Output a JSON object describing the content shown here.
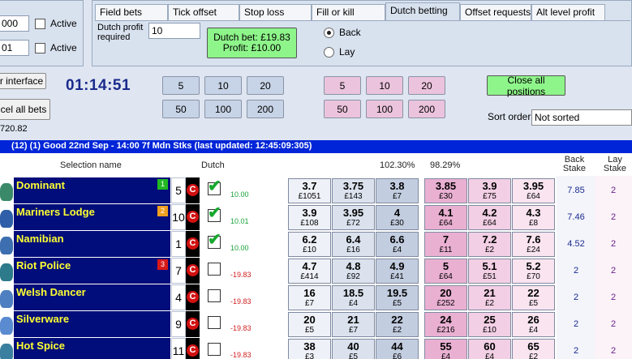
{
  "left_panel": {
    "input1": "000",
    "input2": "01",
    "active_label": "Active"
  },
  "tabs": [
    {
      "label": "Field bets"
    },
    {
      "label": "Tick offset"
    },
    {
      "label": "Stop loss"
    },
    {
      "label": "Fill or kill"
    },
    {
      "label": "Dutch betting"
    },
    {
      "label": "Offset requests"
    },
    {
      "label": "Alt level profit"
    }
  ],
  "dutch": {
    "profit_label_line1": "Dutch profit",
    "profit_label_line2": "required",
    "profit_value": "10",
    "bet_line1": "Dutch bet: £19.83",
    "bet_line2": "Profit: £10.00",
    "back_label": "Back",
    "lay_label": "Lay",
    "selected": "Back"
  },
  "controls": {
    "interface_btn": "r interface",
    "cancel_btn": "cel all bets",
    "balance": "720.82",
    "timer": "01:14:51",
    "back_stakes": [
      "5",
      "10",
      "20",
      "50",
      "100",
      "200"
    ],
    "lay_stakes": [
      "5",
      "10",
      "20",
      "50",
      "100",
      "200"
    ],
    "close_positions": "Close all positions",
    "sort_label": "Sort order",
    "sort_value": "Not sorted"
  },
  "banner": "(12) (1)        Good 22nd Sep - 14:00 7f Mdn Stks (last updated: 12:45:09:305)",
  "headers": {
    "selection": "Selection name",
    "dutch": "Dutch",
    "back_book": "102.30%",
    "lay_book": "98.29%",
    "back_stake_1": "Back",
    "back_stake_2": "Stake",
    "lay_stake_1": "Lay",
    "lay_stake_2": "Stake"
  },
  "colors": {
    "name_bg": "#000d7a",
    "name_fg": "#ffff33",
    "banner": "#0025d8",
    "close_green": "#8ef58a"
  },
  "runners": [
    {
      "name": "Dominant",
      "badge": "1",
      "badge_color": "#22b922",
      "cloth": "5",
      "checked": true,
      "profit": "10.00",
      "back": [
        {
          "p": "3.7",
          "v": "£1051"
        },
        {
          "p": "3.75",
          "v": "£143"
        },
        {
          "p": "3.8",
          "v": "£7"
        }
      ],
      "lay": [
        {
          "p": "3.85",
          "v": "£30"
        },
        {
          "p": "3.9",
          "v": "£75"
        },
        {
          "p": "3.95",
          "v": "£64"
        }
      ],
      "back_stake": "7.85",
      "lay_stake": "2",
      "silk": "#3a8a6a"
    },
    {
      "name": "Mariners Lodge",
      "badge": "2",
      "badge_color": "#f0a020",
      "cloth": "10",
      "checked": true,
      "profit": "10.01",
      "back": [
        {
          "p": "3.9",
          "v": "£108"
        },
        {
          "p": "3.95",
          "v": "£72"
        },
        {
          "p": "4",
          "v": "£30"
        }
      ],
      "lay": [
        {
          "p": "4.1",
          "v": "£64"
        },
        {
          "p": "4.2",
          "v": "£64"
        },
        {
          "p": "4.3",
          "v": "£8"
        }
      ],
      "back_stake": "7.46",
      "lay_stake": "2",
      "silk": "#2e5fa8"
    },
    {
      "name": "Namibian",
      "badge": "",
      "badge_color": "",
      "cloth": "1",
      "checked": true,
      "profit": "10.00",
      "back": [
        {
          "p": "6.2",
          "v": "£10"
        },
        {
          "p": "6.4",
          "v": "£16"
        },
        {
          "p": "6.6",
          "v": "£4"
        }
      ],
      "lay": [
        {
          "p": "7",
          "v": "£11"
        },
        {
          "p": "7.2",
          "v": "£2"
        },
        {
          "p": "7.6",
          "v": "£24"
        }
      ],
      "back_stake": "4.52",
      "lay_stake": "2",
      "silk": "#3d6fb0"
    },
    {
      "name": "Riot Police",
      "badge": "3",
      "badge_color": "#d81818",
      "cloth": "7",
      "checked": false,
      "profit": "-19.83",
      "back": [
        {
          "p": "4.7",
          "v": "£414"
        },
        {
          "p": "4.8",
          "v": "£92"
        },
        {
          "p": "4.9",
          "v": "£41"
        }
      ],
      "lay": [
        {
          "p": "5",
          "v": "£64"
        },
        {
          "p": "5.1",
          "v": "£51"
        },
        {
          "p": "5.2",
          "v": "£70"
        }
      ],
      "back_stake": "2",
      "lay_stake": "2",
      "silk": "#2c7a8a"
    },
    {
      "name": "Welsh Dancer",
      "badge": "",
      "badge_color": "",
      "cloth": "4",
      "checked": false,
      "profit": "-19.83",
      "back": [
        {
          "p": "16",
          "v": "£7"
        },
        {
          "p": "18.5",
          "v": "£4"
        },
        {
          "p": "19.5",
          "v": "£5"
        }
      ],
      "lay": [
        {
          "p": "20",
          "v": "£252"
        },
        {
          "p": "21",
          "v": "£2"
        },
        {
          "p": "22",
          "v": "£5"
        }
      ],
      "back_stake": "2",
      "lay_stake": "2",
      "silk": "#4e7fc0"
    },
    {
      "name": "Silverware",
      "badge": "",
      "badge_color": "",
      "cloth": "9",
      "checked": false,
      "profit": "-19.83",
      "back": [
        {
          "p": "20",
          "v": "£5"
        },
        {
          "p": "21",
          "v": "£7"
        },
        {
          "p": "22",
          "v": "£2"
        }
      ],
      "lay": [
        {
          "p": "24",
          "v": "£216"
        },
        {
          "p": "25",
          "v": "£10"
        },
        {
          "p": "26",
          "v": "£4"
        }
      ],
      "back_stake": "2",
      "lay_stake": "2",
      "silk": "#5a8ad0"
    },
    {
      "name": "Hot Spice",
      "badge": "",
      "badge_color": "",
      "cloth": "11",
      "checked": false,
      "profit": "-19.83",
      "back": [
        {
          "p": "38",
          "v": "£3"
        },
        {
          "p": "40",
          "v": "£5"
        },
        {
          "p": "44",
          "v": "£6"
        }
      ],
      "lay": [
        {
          "p": "55",
          "v": "£4"
        },
        {
          "p": "60",
          "v": "£4"
        },
        {
          "p": "65",
          "v": "£2"
        }
      ],
      "back_stake": "2",
      "lay_stake": "2",
      "silk": "#3a7fa0"
    }
  ]
}
